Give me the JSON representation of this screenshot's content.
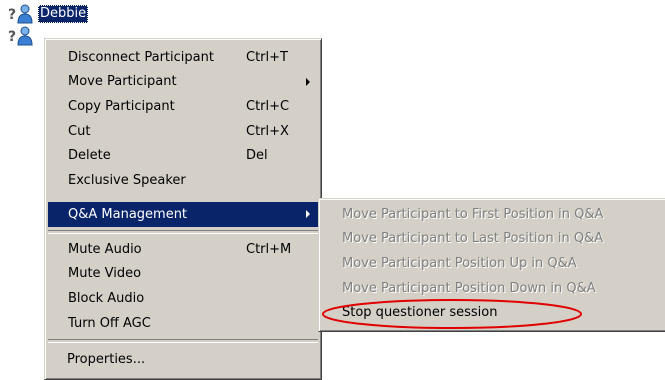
{
  "tree": {
    "nodes": [
      {
        "name": "Debbie",
        "selected": true,
        "icon": "participant-question-icon"
      },
      {
        "name": "",
        "selected": false,
        "icon": "participant-question-icon"
      }
    ]
  },
  "context_menu": {
    "items": [
      {
        "label": "Disconnect Participant",
        "shortcut": "Ctrl+T"
      },
      {
        "label": "Move Participant",
        "shortcut": ""
      },
      {
        "label": "Copy Participant",
        "shortcut": "Ctrl+C"
      },
      {
        "label": "Cut",
        "shortcut": "Ctrl+X"
      },
      {
        "label": "Delete",
        "shortcut": "Del"
      },
      {
        "label": "Exclusive Speaker",
        "shortcut": ""
      },
      {
        "label": "Q&A Management",
        "shortcut": ""
      },
      {
        "label": "Mute Audio",
        "shortcut": "Ctrl+M"
      },
      {
        "label": "Mute Video",
        "shortcut": ""
      },
      {
        "label": "Block Audio",
        "shortcut": ""
      },
      {
        "label": "Turn Off AGC",
        "shortcut": ""
      },
      {
        "label": "Properties...",
        "shortcut": ""
      }
    ]
  },
  "submenu": {
    "items": [
      {
        "label": "Move Participant to First Position in Q&A",
        "enabled": false
      },
      {
        "label": "Move Participant to Last Position in Q&A",
        "enabled": false
      },
      {
        "label": "Move Participant Position Up in Q&A",
        "enabled": false
      },
      {
        "label": "Move Participant Position Down in Q&A",
        "enabled": false
      },
      {
        "label": "Stop questioner session",
        "enabled": true
      }
    ]
  },
  "colors": {
    "menu_bg": "#d4d0c8",
    "highlight": "#0a246a",
    "disabled_text": "#808080",
    "annotation": "#e00000"
  }
}
